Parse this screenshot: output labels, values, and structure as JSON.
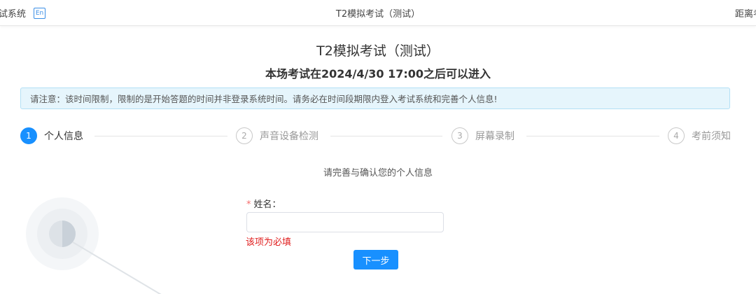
{
  "header": {
    "system_name": "试系统",
    "lang_label": "En",
    "exam_title": "T2模拟考试（测试）",
    "right_text": "距离考"
  },
  "main": {
    "title": "T2模拟考试（测试）",
    "subtitle": "本场考试在2024/4/30 17:00之后可以进入",
    "notice": "请注意：该时间限制，限制的是开始答题的时间并非登录系统时间。请务必在时间段期限内登入考试系统和完善个人信息!"
  },
  "steps": [
    {
      "number": "1",
      "label": "个人信息",
      "active": true
    },
    {
      "number": "2",
      "label": "声音设备检测",
      "active": false
    },
    {
      "number": "3",
      "label": "屏幕录制",
      "active": false
    },
    {
      "number": "4",
      "label": "考前须知",
      "active": false
    }
  ],
  "form": {
    "hint": "请完善与确认您的个人信息",
    "required_mark": "*",
    "name_label": "姓名：",
    "name_value": "",
    "name_placeholder": "",
    "name_error": "该项为必填",
    "next_label": "下一步"
  },
  "colors": {
    "accent": "#1890ff",
    "error": "#e02020",
    "notice_bg": "#e6f5fc"
  }
}
